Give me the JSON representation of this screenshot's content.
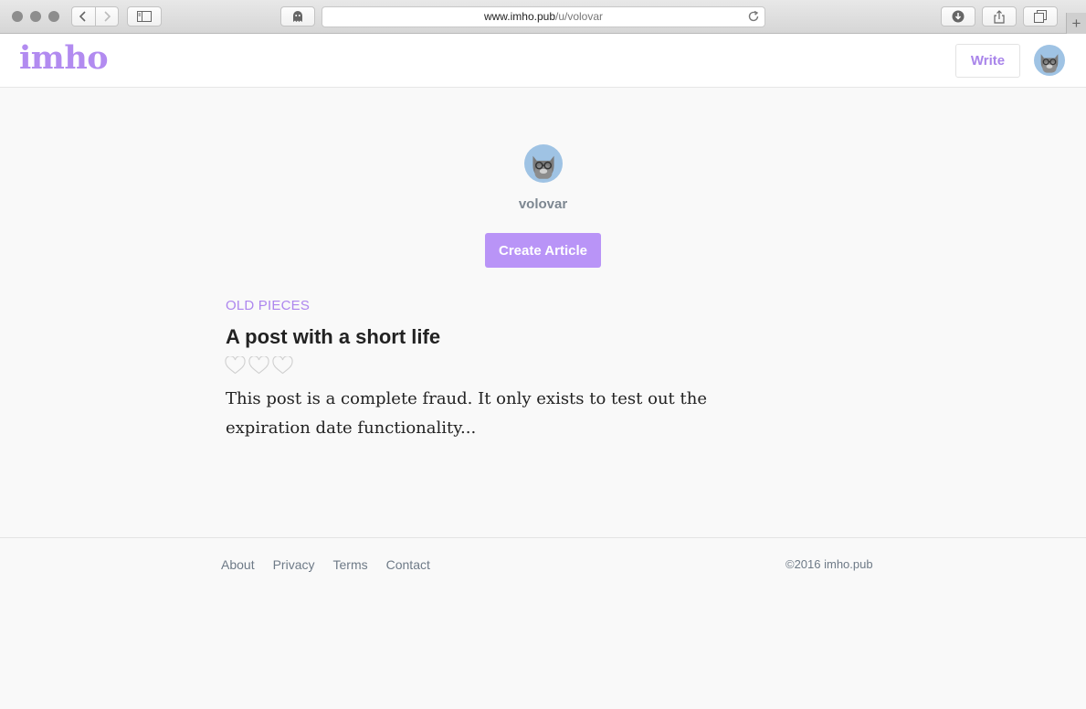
{
  "browser": {
    "url_host": "www.imho.pub",
    "url_path": "/u/volovar",
    "new_tab_glyph": "+"
  },
  "header": {
    "logo": "imho",
    "write_label": "Write"
  },
  "profile": {
    "username": "volovar",
    "create_label": "Create Article"
  },
  "articles": {
    "section_label": "OLD PIECES",
    "items": [
      {
        "title": "A post with a short life",
        "hearts_filled": 0,
        "hearts_total": 3,
        "excerpt": "This post is a complete fraud. It only exists to test out the expiration date functionality..."
      }
    ]
  },
  "footer": {
    "links": [
      "About",
      "Privacy",
      "Terms",
      "Contact"
    ],
    "copyright": "©2016 imho.pub"
  },
  "colors": {
    "brand": "#b28bf0",
    "button": "#b994f7",
    "muted": "#6e7a87"
  },
  "icons": [
    "back-icon",
    "forward-icon",
    "sidebar-icon",
    "ghost-icon",
    "reload-icon",
    "download-icon",
    "share-icon",
    "tabs-icon",
    "heart-icon",
    "avatar-icon"
  ]
}
